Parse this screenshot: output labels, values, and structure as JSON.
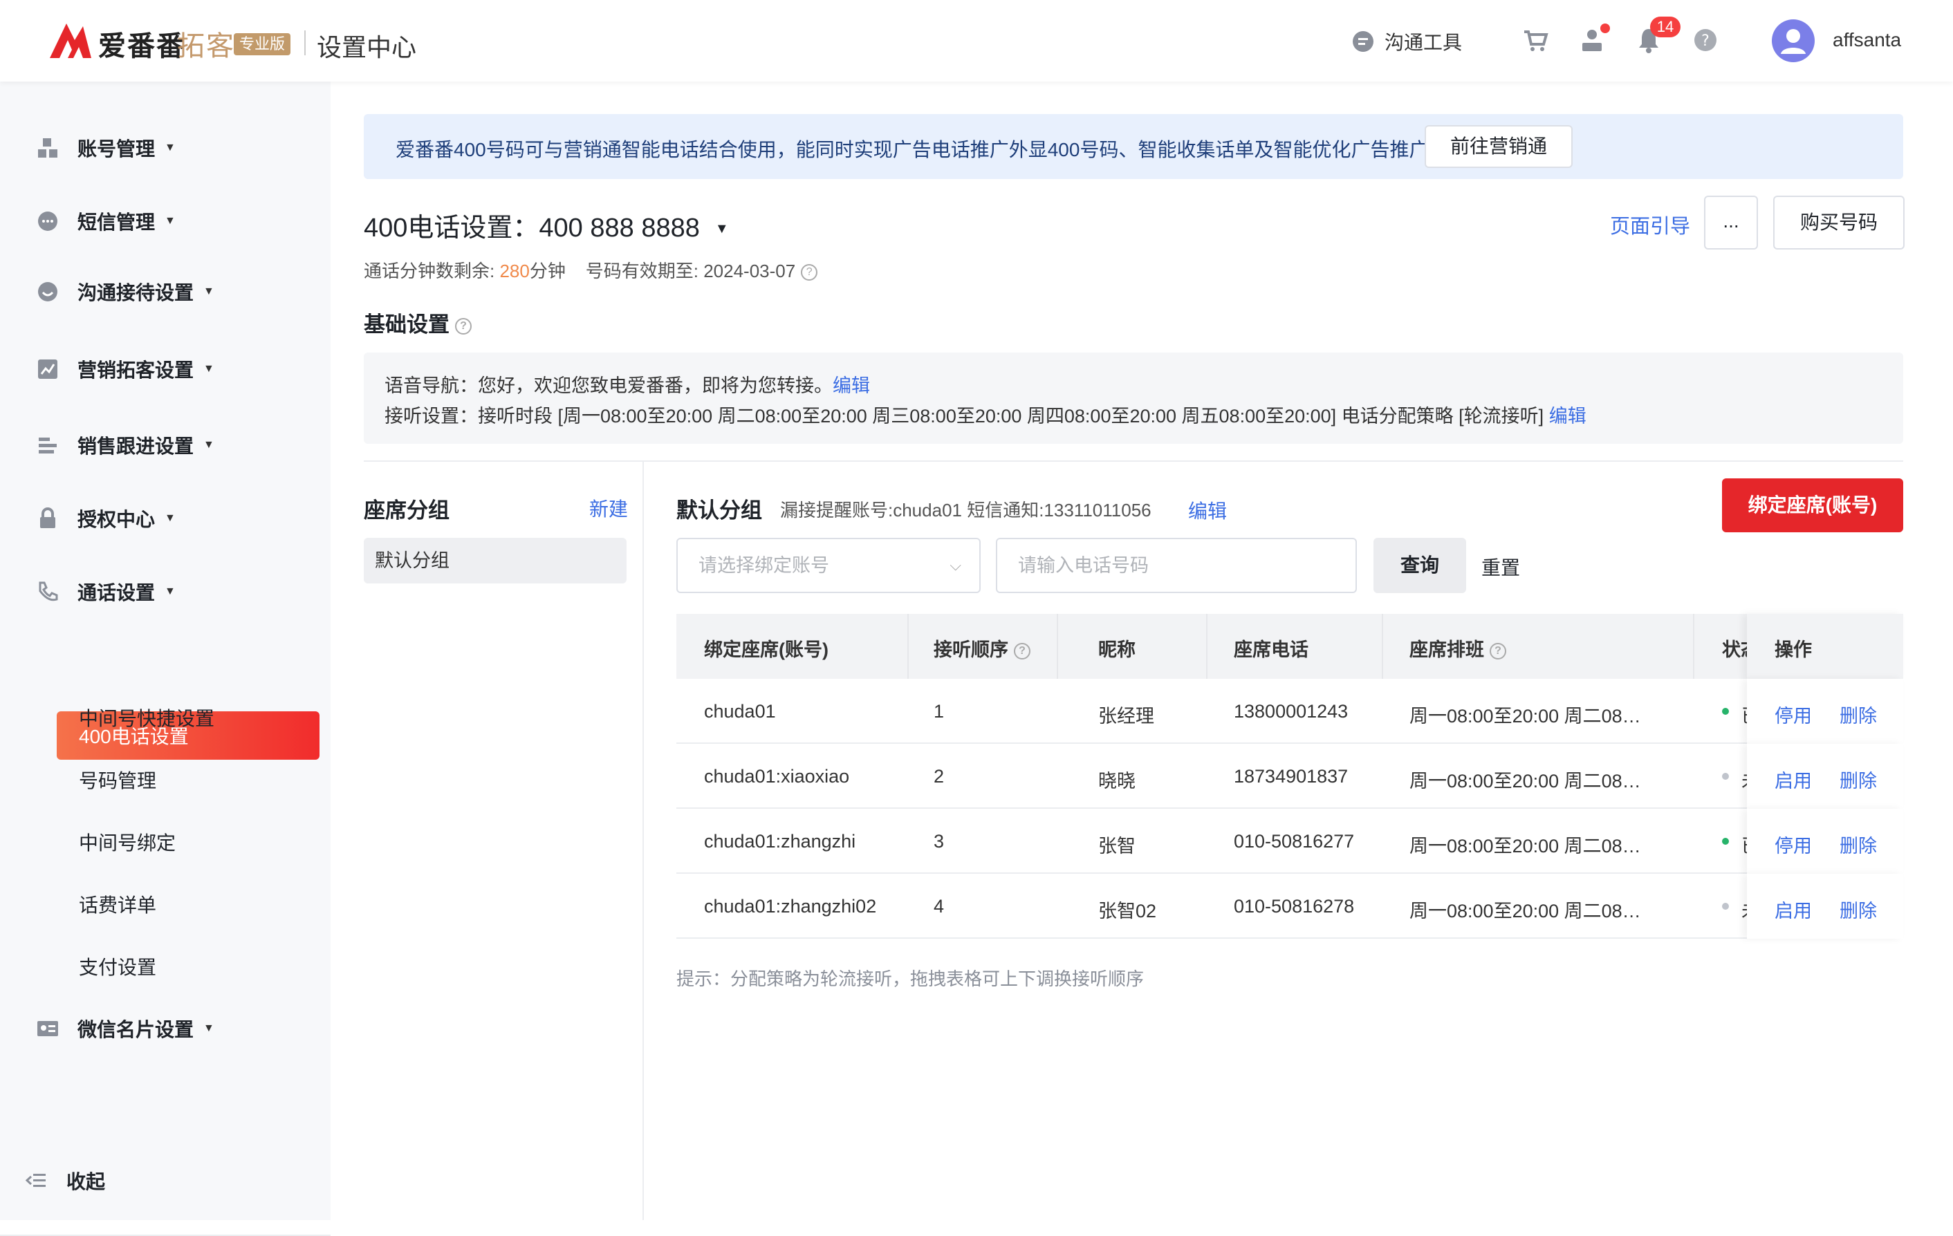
{
  "app": {
    "brand_name": "爱番番",
    "brand_sub": "拓客",
    "brand_badge": "专业版",
    "page_title": "设置中心"
  },
  "topbar": {
    "comm_tool": "沟通工具",
    "notification_count": "14",
    "username": "affsanta"
  },
  "sidebar": {
    "menu": [
      {
        "label": "账号管理",
        "icon": "account-icon"
      },
      {
        "label": "短信管理",
        "icon": "sms-icon"
      },
      {
        "label": "沟通接待设置",
        "icon": "chat-icon"
      },
      {
        "label": "营销拓客设置",
        "icon": "chart-icon"
      },
      {
        "label": "销售跟进设置",
        "icon": "list-icon"
      },
      {
        "label": "授权中心",
        "icon": "lock-icon"
      },
      {
        "label": "通话设置",
        "icon": "phone-icon"
      },
      {
        "label": "微信名片设置",
        "icon": "card-icon"
      }
    ],
    "sub_items": [
      "400电话设置",
      "中间号快捷设置",
      "号码管理",
      "中间号绑定",
      "话费详单",
      "支付设置"
    ],
    "collapse": "收起"
  },
  "banner": {
    "text": "爱番番400号码可与营销通智能电话结合使用，能同时实现广告电话推广外显400号码、智能收集话单及智能优化广告推广",
    "button": "前往营销通"
  },
  "phone": {
    "title_prefix": "400电话设置：",
    "number": "400 888 8888",
    "guide": "页面引导",
    "more": "...",
    "buy": "购买号码",
    "minutes_label": "通话分钟数剩余: ",
    "minutes_value": "280",
    "minutes_unit": "分钟",
    "expiry": "号码有效期至: 2024-03-07"
  },
  "basic": {
    "title": "基础设置",
    "line1": "语音导航：您好，欢迎您致电爱番番，即将为您转接。",
    "line2": "接听设置：接听时段 [周一08:00至20:00 周二08:00至20:00 周三08:00至20:00 周四08:00至20:00 周五08:00至20:00] 电话分配策略 [轮流接听]",
    "edit": "编辑"
  },
  "groups": {
    "title": "座席分组",
    "new": "新建",
    "items": [
      "默认分组"
    ]
  },
  "default_group": {
    "title": "默认分组",
    "meta": "漏接提醒账号:chuda01  短信通知:13311011056",
    "edit": "编辑",
    "bind_button": "绑定座席(账号)",
    "account_placeholder": "请选择绑定账号",
    "phone_placeholder": "请输入电话号码",
    "query": "查询",
    "reset": "重置"
  },
  "table": {
    "headers": [
      "绑定座席(账号)",
      "接听顺序",
      "昵称",
      "座席电话",
      "座席排班",
      "状态",
      "操作"
    ],
    "rows": [
      {
        "account": "chuda01",
        "order": "1",
        "nickname": "张经理",
        "phone": "13800001243",
        "schedule": "周一08:00至20:00 周二08…",
        "status": "已",
        "status_color": "#27b36a",
        "toggle": "停用",
        "delete": "删除"
      },
      {
        "account": "chuda01:xiaoxiao",
        "order": "2",
        "nickname": "晓晓",
        "phone": "18734901837",
        "schedule": "周一08:00至20:00 周二08…",
        "status": "未",
        "status_color": "#c0c4cc",
        "toggle": "启用",
        "delete": "删除"
      },
      {
        "account": "chuda01:zhangzhi",
        "order": "3",
        "nickname": "张智",
        "phone": "010-50816277",
        "schedule": "周一08:00至20:00 周二08…",
        "status": "已",
        "status_color": "#27b36a",
        "toggle": "停用",
        "delete": "删除"
      },
      {
        "account": "chuda01:zhangzhi02",
        "order": "4",
        "nickname": "张智02",
        "phone": "010-50816278",
        "schedule": "周一08:00至20:00 周二08…",
        "status": "未",
        "status_color": "#c0c4cc",
        "toggle": "启用",
        "delete": "删除"
      }
    ],
    "hint": "提示：分配策略为轮流接听，拖拽表格可上下调换接听顺序"
  },
  "colors": {
    "accent": "#e5262a",
    "link": "#3b6de3",
    "banner_bg": "#e8f0fd",
    "orange": "#f08a4b"
  }
}
